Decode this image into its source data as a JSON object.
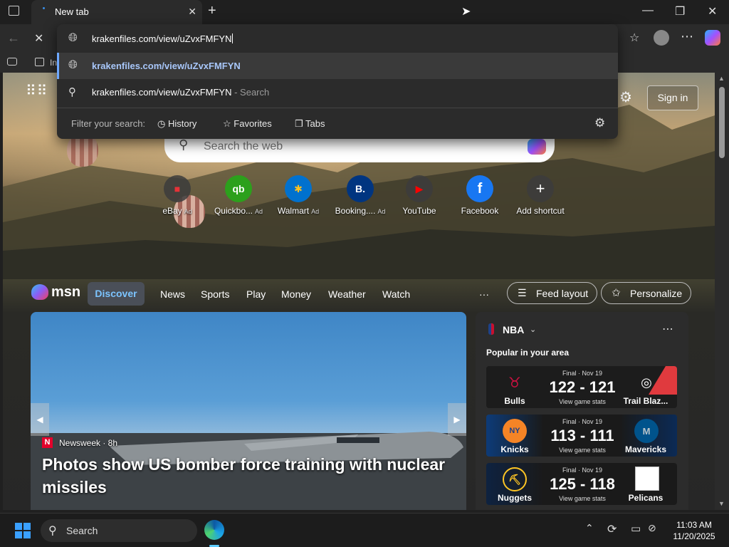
{
  "browser": {
    "tab_title": "New tab",
    "address_value": "krakenfiles.com/view/uZvxFMFYN",
    "favorites_bar_item": "In"
  },
  "dropdown": {
    "suggestion_url": "krakenfiles.com/view/uZvxFMFYN",
    "suggestion_search": "krakenfiles.com/view/uZvxFMFYN",
    "suggestion_search_suffix": "- Search",
    "filter_label": "Filter your search:",
    "filter_history": "History",
    "filter_favorites": "Favorites",
    "filter_tabs": "Tabs"
  },
  "newtab": {
    "sign_in": "Sign in",
    "search_placeholder": "Search the web",
    "shortcuts": [
      {
        "label": "eBay",
        "ad": "Ad",
        "glyph": "■",
        "color": "#e53238"
      },
      {
        "label": "Quickbo...",
        "ad": "Ad",
        "glyph": "qb",
        "color": "#2ca01c"
      },
      {
        "label": "Walmart",
        "ad": "Ad",
        "glyph": "✱",
        "color": "#0071ce"
      },
      {
        "label": "Booking....",
        "ad": "Ad",
        "glyph": "B.",
        "color": "#003580"
      },
      {
        "label": "YouTube",
        "ad": "",
        "glyph": "▶",
        "color": "#ff0000"
      },
      {
        "label": "Facebook",
        "ad": "",
        "glyph": "f",
        "color": "#1877f2"
      },
      {
        "label": "Add shortcut",
        "ad": "",
        "glyph": "+",
        "color": "#cccccc"
      }
    ]
  },
  "msn": {
    "brand": "msn",
    "tabs": [
      "Discover",
      "News",
      "Sports",
      "Play",
      "Money",
      "Weather",
      "Watch"
    ],
    "more": "···",
    "feed_layout": "Feed layout",
    "personalize": "Personalize",
    "feature": {
      "source": "Newsweek · 8h",
      "headline": "Photos show US bomber force training with nuclear missiles"
    }
  },
  "nba": {
    "title": "NBA",
    "subtitle": "Popular in your area",
    "games": [
      {
        "status": "Final · Nov 19",
        "score": "122 - 121",
        "stats": "View game stats",
        "home": "Bulls",
        "away": "Trail Blaz...",
        "home_color": "#ce1141",
        "away_color": "#e03a3e"
      },
      {
        "status": "Final · Nov 19",
        "score": "113 - 111",
        "stats": "View game stats",
        "home": "Knicks",
        "away": "Mavericks",
        "home_color": "#f58426",
        "away_color": "#00538c"
      },
      {
        "status": "Final · Nov 19",
        "score": "125 - 118",
        "stats": "View game stats",
        "home": "Nuggets",
        "away": "Pelicans",
        "home_color": "#fec524",
        "away_color": "#0c2340"
      }
    ]
  },
  "taskbar": {
    "search_label": "Search",
    "time": "11:03 AM",
    "date": "11/20/2025"
  }
}
